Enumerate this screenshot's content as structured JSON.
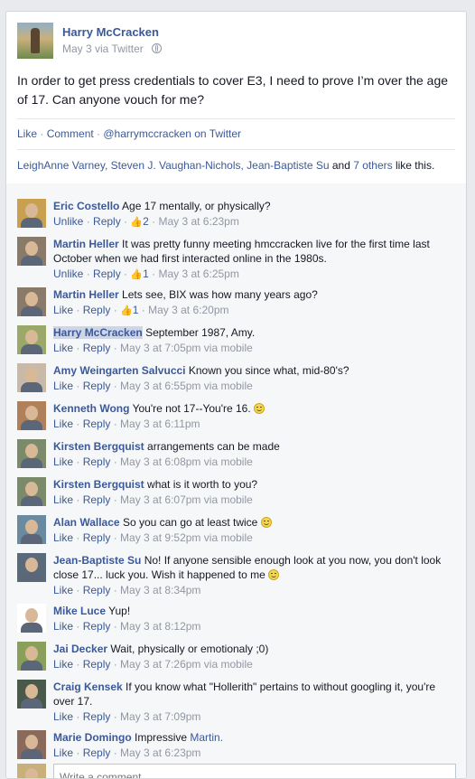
{
  "post": {
    "author": "Harry McCracken",
    "meta": "May 3 via Twitter",
    "text": "In order to get press credentials to cover E3, I need to prove I’m over the age of 17. Can anyone vouch for me?"
  },
  "actions": {
    "like": "Like",
    "comment": "Comment",
    "twitter": "@harrymccracken on Twitter",
    "sep": " · "
  },
  "likes": {
    "names": "LeighAnne Varney, Steven J. Vaughan-Nichols, Jean-Baptiste Su",
    "and": " and ",
    "others": "7 others",
    "suffix": " like this."
  },
  "comments": [
    {
      "author": "Eric Costello",
      "text": "Age 17 mentally, or physically?",
      "action": "Unlike",
      "likes": "2",
      "time": "May 3 at 6:23pm",
      "via": ""
    },
    {
      "author": "Martin Heller",
      "text": "It was pretty funny meeting hmccracken live for the first time last October when we had first interacted online in the 1980s.",
      "action": "Unlike",
      "likes": "1",
      "time": "May 3 at 6:25pm",
      "via": ""
    },
    {
      "author": "Martin Heller",
      "text": "Lets see, BIX was how many years ago?",
      "action": "Like",
      "likes": "1",
      "time": "May 3 at 6:20pm",
      "via": ""
    },
    {
      "author": "Harry McCracken",
      "text": "September 1987, Amy.",
      "action": "Like",
      "likes": "",
      "time": "May 3 at 7:05pm",
      "via": "via mobile"
    },
    {
      "author": "Amy Weingarten Salvucci",
      "text": "Known you since what, mid-80's?",
      "action": "Like",
      "likes": "",
      "time": "May 3 at 6:55pm",
      "via": "via mobile"
    },
    {
      "author": "Kenneth Wong",
      "text": "You're not 17--You're 16.",
      "action": "Like",
      "likes": "",
      "time": "May 3 at 6:11pm",
      "via": ""
    },
    {
      "author": "Kirsten Bergquist",
      "text": "arrangements can be made",
      "action": "Like",
      "likes": "",
      "time": "May 3 at 6:08pm",
      "via": "via mobile"
    },
    {
      "author": "Kirsten Bergquist",
      "text": "what is it worth to you?",
      "action": "Like",
      "likes": "",
      "time": "May 3 at 6:07pm",
      "via": "via mobile"
    },
    {
      "author": "Alan Wallace",
      "text": "So you can go at least twice",
      "action": "Like",
      "likes": "",
      "time": "May 3 at 9:52pm",
      "via": "via mobile"
    },
    {
      "author": "Jean-Baptiste Su",
      "text": "No! If anyone sensible enough look at you now, you don't look close 17... luck you. Wish it happened to me",
      "action": "Like",
      "likes": "",
      "time": "May 3 at 8:34pm",
      "via": ""
    },
    {
      "author": "Mike Luce",
      "text": "Yup!",
      "action": "Like",
      "likes": "",
      "time": "May 3 at 8:12pm",
      "via": ""
    },
    {
      "author": "Jai Decker",
      "text": "Wait, physically or emotionaly ;0)",
      "action": "Like",
      "likes": "",
      "time": "May 3 at 7:26pm",
      "via": "via mobile"
    },
    {
      "author": "Craig Kensek",
      "text": "If you know what \"Hollerith\" pertains to without googling it, you're over 17.",
      "action": "Like",
      "likes": "",
      "time": "May 3 at 7:09pm",
      "via": ""
    },
    {
      "author": "Marie Domingo",
      "text": "Impressive",
      "mention": "Martin.",
      "action": "Like",
      "likes": "",
      "time": "May 3 at 6:23pm",
      "via": ""
    }
  ],
  "reply_label": "Reply",
  "write_placeholder": "Write a comment...",
  "colors": {
    "link": "#3b5998",
    "meta": "#9197a3",
    "background": "#e9eaed"
  }
}
